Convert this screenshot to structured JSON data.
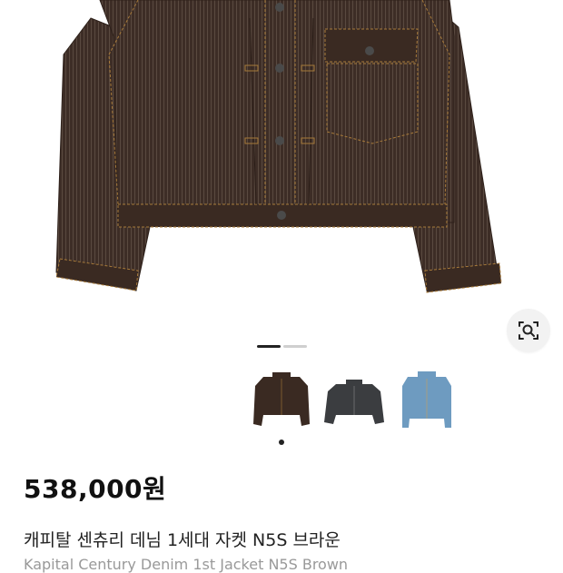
{
  "product": {
    "price": "538,000원",
    "title": "캐피탈 센츄리 데님 1세대 자켓 N5S 브라운",
    "subtitle_partial": "Kapital Century Denim 1st Jacket N5S Brown"
  },
  "gallery": {
    "current_index": 1,
    "total": 2,
    "thumbnails": [
      {
        "color_name": "brown",
        "color": "#3a2a22",
        "selected": true
      },
      {
        "color_name": "charcoal",
        "color": "#3b3d40",
        "selected": false
      },
      {
        "color_name": "light-blue",
        "color": "#6e9bc0",
        "selected": false
      }
    ]
  },
  "icons": {
    "lens": "image-search-icon"
  }
}
